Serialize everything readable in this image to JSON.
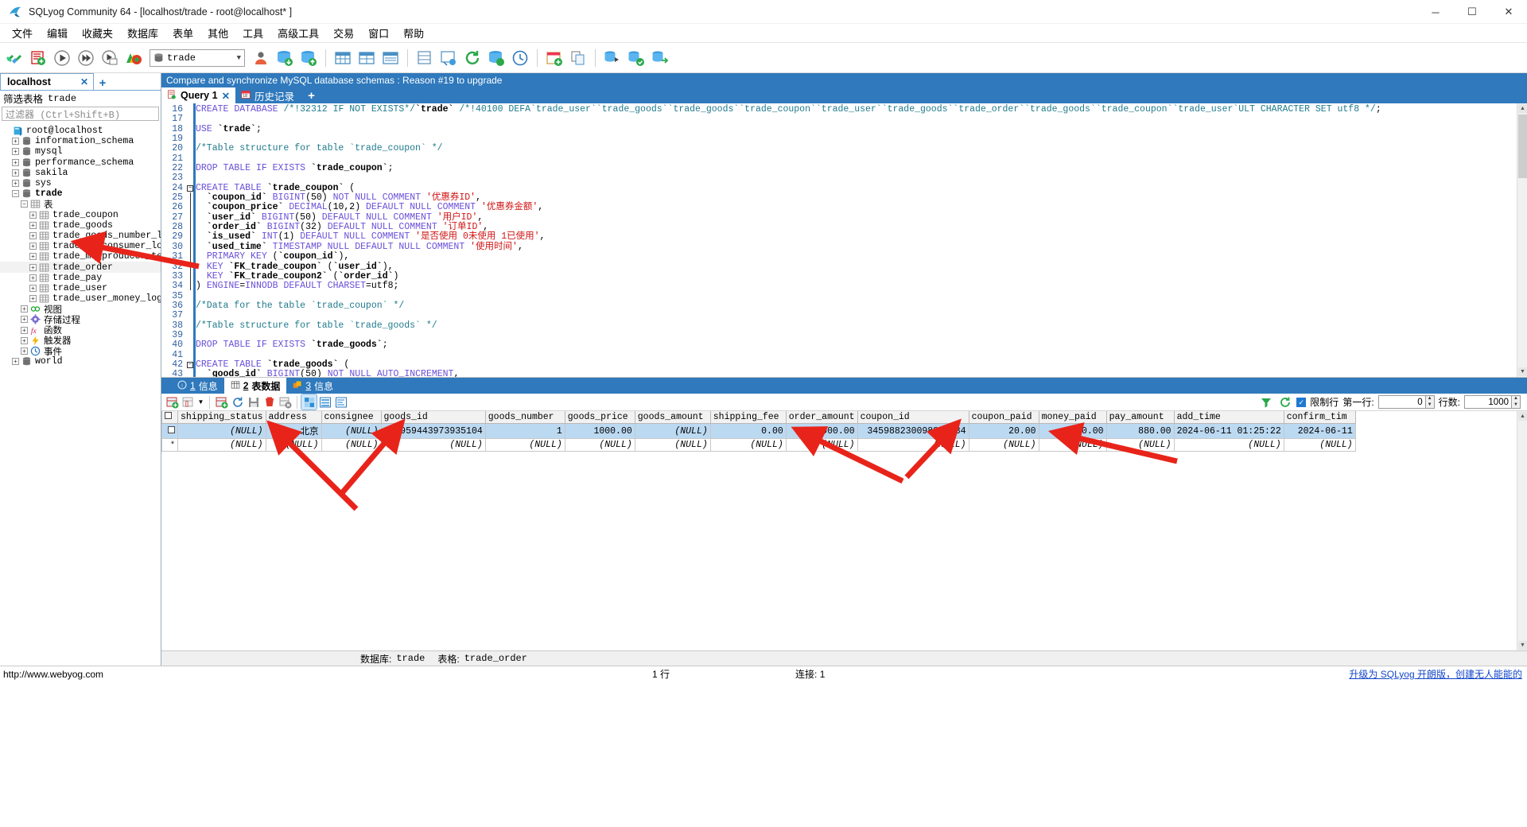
{
  "window": {
    "title": "SQLyog Community 64 - [localhost/trade - root@localhost* ]",
    "minimize": "─",
    "maximize": "☐",
    "close": "✕"
  },
  "menubar": [
    "文件",
    "编辑",
    "收藏夹",
    "数据库",
    "表单",
    "其他",
    "工具",
    "高级工具",
    "交易",
    "窗口",
    "帮助"
  ],
  "toolbar": {
    "db_selected": "trade",
    "icons": [
      "new-connection-icon",
      "new-query-icon",
      "execute-query-icon",
      "execute-all-icon",
      "execute-partial-icon",
      "stop-query-icon",
      "user-manager-icon",
      "backup-database-icon",
      "restore-database-icon",
      "table-data-icon",
      "table-grid-icon",
      "table-info-icon",
      "sql-formatter-icon",
      "schema-designer-icon",
      "refresh-icon",
      "import-external-icon",
      "history-icon",
      "scheduler-icon",
      "new-table-icon",
      "copy-table-icon",
      "sync-database-icon",
      "compare-database-icon",
      "migrate-database-icon"
    ]
  },
  "left": {
    "connection_tab": "localhost",
    "close_tab": "✕",
    "add_tab": "+",
    "filter_label": "筛选表格",
    "filter_db": "trade",
    "filter_placeholder": "过滤器 (Ctrl+Shift+B)",
    "tree": [
      {
        "label": "root@localhost",
        "depth": 0,
        "expander": "",
        "icon": "server-icon",
        "bold": false,
        "selected": false
      },
      {
        "label": "information_schema",
        "depth": 1,
        "expander": "+",
        "icon": "database-icon",
        "bold": false,
        "selected": false
      },
      {
        "label": "mysql",
        "depth": 1,
        "expander": "+",
        "icon": "database-icon",
        "bold": false,
        "selected": false
      },
      {
        "label": "performance_schema",
        "depth": 1,
        "expander": "+",
        "icon": "database-icon",
        "bold": false,
        "selected": false
      },
      {
        "label": "sakila",
        "depth": 1,
        "expander": "+",
        "icon": "database-icon",
        "bold": false,
        "selected": false
      },
      {
        "label": "sys",
        "depth": 1,
        "expander": "+",
        "icon": "database-icon",
        "bold": false,
        "selected": false
      },
      {
        "label": "trade",
        "depth": 1,
        "expander": "−",
        "icon": "database-icon",
        "bold": true,
        "selected": false
      },
      {
        "label": "表",
        "depth": 2,
        "expander": "−",
        "icon": "tables-folder-icon",
        "bold": false,
        "selected": false
      },
      {
        "label": "trade_coupon",
        "depth": 3,
        "expander": "+",
        "icon": "table-icon",
        "bold": false,
        "selected": false
      },
      {
        "label": "trade_goods",
        "depth": 3,
        "expander": "+",
        "icon": "table-icon",
        "bold": false,
        "selected": false
      },
      {
        "label": "trade_goods_number_log",
        "depth": 3,
        "expander": "+",
        "icon": "table-icon",
        "bold": false,
        "selected": false
      },
      {
        "label": "trade_mq_consumer_log",
        "depth": 3,
        "expander": "+",
        "icon": "table-icon",
        "bold": false,
        "selected": false
      },
      {
        "label": "trade_mq_producer_temp",
        "depth": 3,
        "expander": "+",
        "icon": "table-icon",
        "bold": false,
        "selected": false
      },
      {
        "label": "trade_order",
        "depth": 3,
        "expander": "+",
        "icon": "table-icon",
        "bold": false,
        "selected": true
      },
      {
        "label": "trade_pay",
        "depth": 3,
        "expander": "+",
        "icon": "table-icon",
        "bold": false,
        "selected": false
      },
      {
        "label": "trade_user",
        "depth": 3,
        "expander": "+",
        "icon": "table-icon",
        "bold": false,
        "selected": false
      },
      {
        "label": "trade_user_money_log",
        "depth": 3,
        "expander": "+",
        "icon": "table-icon",
        "bold": false,
        "selected": false
      },
      {
        "label": "视图",
        "depth": 2,
        "expander": "+",
        "icon": "views-icon",
        "bold": false,
        "selected": false
      },
      {
        "label": "存储过程",
        "depth": 2,
        "expander": "+",
        "icon": "procedures-icon",
        "bold": false,
        "selected": false
      },
      {
        "label": "函数",
        "depth": 2,
        "expander": "+",
        "icon": "functions-icon",
        "bold": false,
        "selected": false
      },
      {
        "label": "触发器",
        "depth": 2,
        "expander": "+",
        "icon": "triggers-icon",
        "bold": false,
        "selected": false
      },
      {
        "label": "事件",
        "depth": 2,
        "expander": "+",
        "icon": "events-icon",
        "bold": false,
        "selected": false
      },
      {
        "label": "world",
        "depth": 1,
        "expander": "+",
        "icon": "database-icon",
        "bold": false,
        "selected": false
      }
    ]
  },
  "editor": {
    "banner": "Compare and synchronize MySQL database schemas : Reason #19 to upgrade",
    "tabs": [
      {
        "label": "Query 1",
        "icon": "query-tab-icon",
        "active": true,
        "close": "✕"
      },
      {
        "label": "历史记录",
        "icon": "history-tab-icon",
        "active": false,
        "close": ""
      }
    ],
    "add_tab": "+",
    "first_line_number": 16,
    "lines": [
      {
        "n": 16,
        "text": "CREATE DATABASE /*!32312 IF NOT EXISTS*/`trade` /*!40100 DEFA`trade_user``trade_goods``trade_goods``trade_coupon``trade_user``trade_goods``trade_order``trade_goods``trade_coupon``trade_user`ULT CHARACTER SET utf8 */;"
      },
      {
        "n": 17,
        "text": ""
      },
      {
        "n": 18,
        "text": "USE `trade`;"
      },
      {
        "n": 19,
        "text": ""
      },
      {
        "n": 20,
        "text": "/*Table structure for table `trade_coupon` */"
      },
      {
        "n": 21,
        "text": ""
      },
      {
        "n": 22,
        "text": "DROP TABLE IF EXISTS `trade_coupon`;"
      },
      {
        "n": 23,
        "text": ""
      },
      {
        "n": 24,
        "text": "CREATE TABLE `trade_coupon` ("
      },
      {
        "n": 25,
        "text": "  `coupon_id` BIGINT(50) NOT NULL COMMENT '优惠券ID',"
      },
      {
        "n": 26,
        "text": "  `coupon_price` DECIMAL(10,2) DEFAULT NULL COMMENT '优惠券金额',"
      },
      {
        "n": 27,
        "text": "  `user_id` BIGINT(50) DEFAULT NULL COMMENT '用户ID',"
      },
      {
        "n": 28,
        "text": "  `order_id` BIGINT(32) DEFAULT NULL COMMENT '订单ID',"
      },
      {
        "n": 29,
        "text": "  `is_used` INT(1) DEFAULT NULL COMMENT '是否使用 0未使用 1已使用',"
      },
      {
        "n": 30,
        "text": "  `used_time` TIMESTAMP NULL DEFAULT NULL COMMENT '使用时间',"
      },
      {
        "n": 31,
        "text": "  PRIMARY KEY (`coupon_id`),"
      },
      {
        "n": 32,
        "text": "  KEY `FK_trade_coupon` (`user_id`),"
      },
      {
        "n": 33,
        "text": "  KEY `FK_trade_coupon2` (`order_id`)"
      },
      {
        "n": 34,
        "text": ") ENGINE=INNODB DEFAULT CHARSET=utf8;"
      },
      {
        "n": 35,
        "text": ""
      },
      {
        "n": 36,
        "text": "/*Data for the table `trade_coupon` */"
      },
      {
        "n": 37,
        "text": ""
      },
      {
        "n": 38,
        "text": "/*Table structure for table `trade_goods` */"
      },
      {
        "n": 39,
        "text": ""
      },
      {
        "n": 40,
        "text": "DROP TABLE IF EXISTS `trade_goods`;"
      },
      {
        "n": 41,
        "text": ""
      },
      {
        "n": 42,
        "text": "CREATE TABLE `trade_goods` ("
      },
      {
        "n": 43,
        "text": "  `goods_id` BIGINT(50) NOT NULL AUTO_INCREMENT,"
      }
    ]
  },
  "results": {
    "tabs": [
      {
        "num": "1",
        "label": "信息",
        "icon": "info-icon",
        "active": false
      },
      {
        "num": "2",
        "label": "表数据",
        "icon": "table-data-icon",
        "active": true
      },
      {
        "num": "3",
        "label": "信息",
        "icon": "objects-info-icon",
        "active": false
      }
    ],
    "toolbar_icons": [
      "insert-row-icon",
      "insert-blank-row-icon",
      "dropdown-caret-icon",
      "duplicate-row-icon",
      "refresh-data-icon",
      "save-changes-icon",
      "delete-row-icon",
      "cancel-edit-icon",
      "grid-view-icon",
      "form-view-icon",
      "text-view-icon"
    ],
    "limit_label": "限制行",
    "limit_checked": true,
    "first_row_label": "第一行:",
    "first_row_value": "0",
    "rows_label": "行数:",
    "rows_value": "1000",
    "right_icons": [
      "filter-icon",
      "refresh-grid-icon"
    ],
    "columns": [
      "shipping_status",
      "address",
      "consignee",
      "goods_id",
      "goods_number",
      "goods_price",
      "goods_amount",
      "shipping_fee",
      "order_amount",
      "coupon_id",
      "coupon_paid",
      "money_paid",
      "pay_amount",
      "add_time",
      "confirm_tim"
    ],
    "rows": [
      {
        "selected": true,
        "cells": [
          "(NULL)",
          "北京",
          "(NULL)",
          "345959443973935104",
          "1",
          "1000.00",
          "(NULL)",
          "0.00",
          "1000.00",
          "345988230098857984",
          "20.00",
          "100.00",
          "880.00",
          "2024-06-11 01:25:22",
          "2024-06-11"
        ]
      },
      {
        "selected": false,
        "cells": [
          "(NULL)",
          "(NULL)",
          "(NULL)",
          "(NULL)",
          "(NULL)",
          "(NULL)",
          "(NULL)",
          "(NULL)",
          "(NULL)",
          "(NULL)",
          "(NULL)",
          "(NULL)",
          "(NULL)",
          "(NULL)",
          "(NULL)"
        ]
      }
    ]
  },
  "dbbar": {
    "db_label": "数据库:",
    "db_value": "trade",
    "table_label": "表格:",
    "table_value": "trade_order"
  },
  "statusbar": {
    "url": "http://www.webyog.com",
    "rows": "1 行",
    "connection_label": "连接:",
    "connection_value": "1",
    "upgrade": "升级为 SQLyog 开朗版，创建无人能能的"
  },
  "colors": {
    "accent": "#2f79bc",
    "selection": "#bcd9f2",
    "arrow": "#e8241a",
    "keyword": "#6a4fd8",
    "comment": "#1f7a8c",
    "string": "#d01414"
  }
}
